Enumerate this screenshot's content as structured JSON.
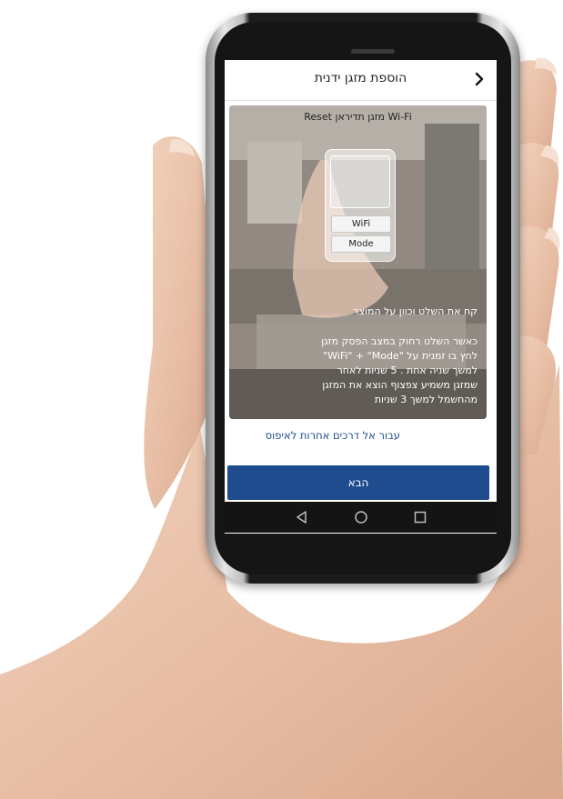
{
  "header": {
    "title": "הוספת מזגן ידנית",
    "back_icon": "chevron-right-icon"
  },
  "card": {
    "title": "Wi-Fi מזגן תדיראן Reset",
    "remote": {
      "wifi_label": "WiFi",
      "mode_label": "Mode"
    },
    "instruction_lead": "קח את השלט וכוון על המוצר",
    "instruction_lines": [
      "כאשר השלט רחוק במצב הפסק מזגן",
      "לחץ בו זמנית על \"WiFi\" + \"Mode\"",
      "למשך שניה אחת . 5 שניות לאחר",
      "שמזגן משמיע צפצוף הוצא את המזגן",
      "מהחשמל למשך 3 שניות"
    ]
  },
  "alt_link": "עבור אל דרכים אחרות לאיפוס",
  "next_button": "הבא",
  "navbar": {
    "icons": [
      "back-triangle-icon",
      "home-circle-icon",
      "recents-square-icon"
    ]
  },
  "colors": {
    "accent": "#1f4b8f",
    "link": "#1f4d8e",
    "navbar": "#141414"
  }
}
